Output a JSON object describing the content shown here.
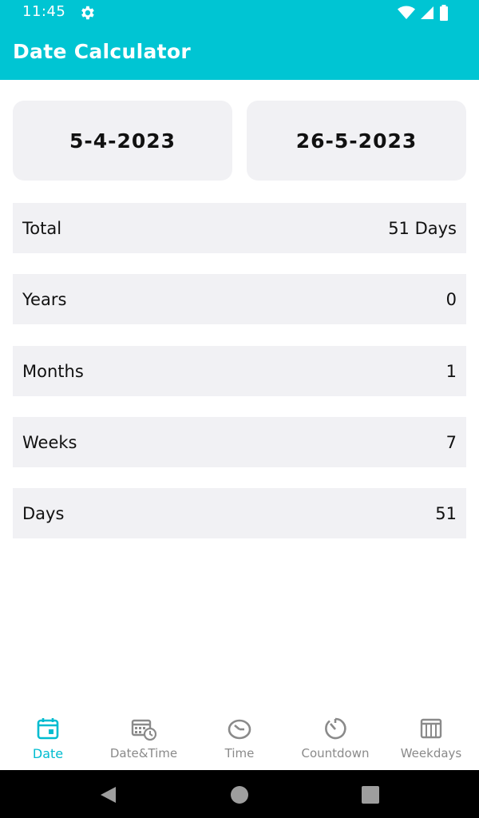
{
  "status_bar": {
    "time": "11:45"
  },
  "app_bar": {
    "title": "Date Calculator"
  },
  "dates": {
    "start": "5-4-2023",
    "end": "26-5-2023"
  },
  "results": [
    {
      "label": "Total",
      "value": "51 Days"
    },
    {
      "label": "Years",
      "value": "0"
    },
    {
      "label": "Months",
      "value": "1"
    },
    {
      "label": "Weeks",
      "value": "7"
    },
    {
      "label": "Days",
      "value": "51"
    }
  ],
  "bottom_nav": {
    "items": [
      {
        "label": "Date",
        "icon": "calendar-icon",
        "active": true
      },
      {
        "label": "Date&Time",
        "icon": "calendar-clock-icon",
        "active": false
      },
      {
        "label": "Time",
        "icon": "clock-icon",
        "active": false
      },
      {
        "label": "Countdown",
        "icon": "timer-icon",
        "active": false
      },
      {
        "label": "Weekdays",
        "icon": "week-grid-icon",
        "active": false
      }
    ]
  },
  "colors": {
    "accent": "#00C5D3",
    "active_nav": "#00BCD0",
    "row_bg": "#F1F1F4",
    "inactive_nav": "#8A8A8A"
  }
}
